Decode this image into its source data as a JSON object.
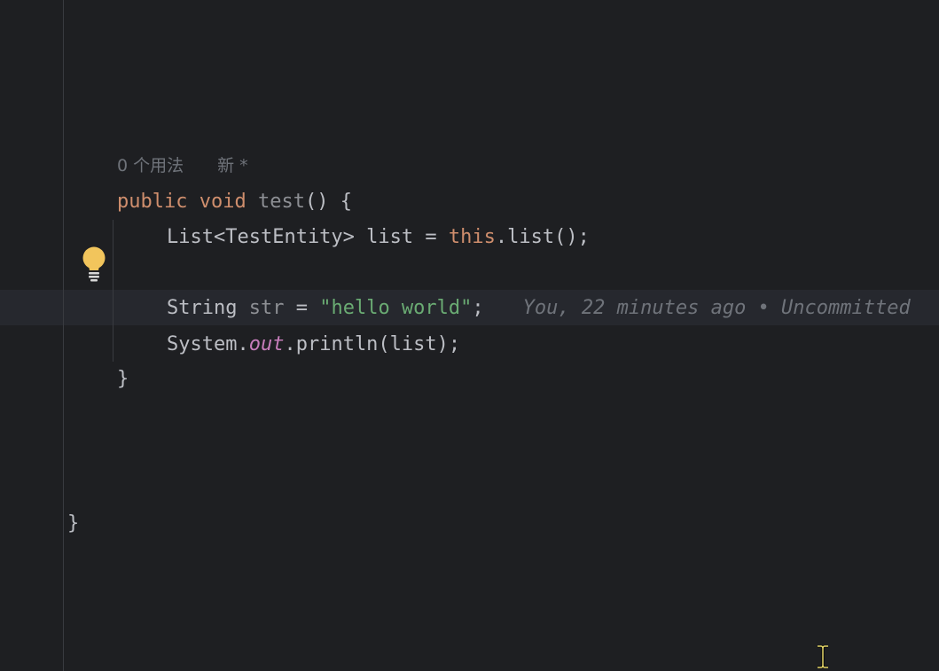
{
  "code_hint": {
    "usages": "0 个用法",
    "status": "新 *"
  },
  "code": {
    "line1": {
      "kw_public": "public",
      "kw_void": "void",
      "method": "test",
      "rest": "() {"
    },
    "line2": {
      "type": "List<TestEntity>",
      "var": " list = ",
      "kw_this": "this",
      "rest": ".list();"
    },
    "line3": {
      "type": "String ",
      "var": "str",
      "eq": " = ",
      "str": "\"hello world\"",
      "semi": ";"
    },
    "line4": {
      "cls": "System.",
      "field": "out",
      "rest": ".println(list);"
    },
    "line5": "}",
    "line6": "}"
  },
  "blame": {
    "text": "You, 22 minutes ago • Uncommitted"
  },
  "icons": {
    "intention": "lightbulb-icon",
    "mouse_cursor": "text-cursor-icon"
  },
  "colors": {
    "background": "#1e1f22",
    "keyword": "#cf8e6d",
    "string": "#6aab73",
    "static_field": "#c77dbb",
    "bulb": "#f2c55c"
  }
}
